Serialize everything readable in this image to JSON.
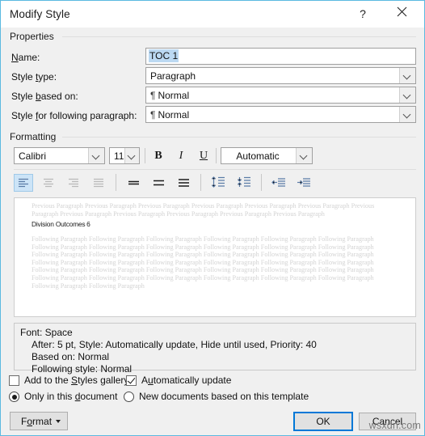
{
  "window": {
    "title": "Modify Style",
    "help_label": "?",
    "close_label": "✕"
  },
  "properties": {
    "group_label": "Properties",
    "name_label": "Name:",
    "name_value": "TOC 1",
    "style_type_label": "Style type:",
    "style_type_value": "Paragraph",
    "style_based_on_label": "Style based on:",
    "style_based_on_value": "Normal",
    "style_following_label": "Style for following paragraph:",
    "style_following_value": "Normal",
    "pilcrow": "¶"
  },
  "formatting": {
    "group_label": "Formatting",
    "font_family": "Calibri",
    "font_size": "11",
    "bold_label": "B",
    "italic_label": "I",
    "underline_label": "U",
    "font_color": "Automatic",
    "icons": {
      "align_left": "align-left-icon",
      "align_center": "align-center-icon",
      "align_right": "align-right-icon",
      "align_justify": "align-justify-icon",
      "line_spacing_1": "line-spacing-single-icon",
      "line_spacing_15": "line-spacing-1-5-icon",
      "line_spacing_2": "line-spacing-double-icon",
      "space_before": "increase-paragraph-spacing-icon",
      "space_after": "decrease-paragraph-spacing-icon",
      "decrease_indent": "decrease-indent-icon",
      "increase_indent": "increase-indent-icon"
    }
  },
  "preview": {
    "previous_paragraph": "Previous Paragraph Previous Paragraph Previous Paragraph Previous Paragraph Previous Paragraph Previous Paragraph Previous Paragraph Previous Paragraph Previous Paragraph Previous Paragraph Previous Paragraph Previous Paragraph",
    "sample_text": "Division Outcomes\t6",
    "following_paragraph": "Following Paragraph Following Paragraph Following Paragraph Following Paragraph Following Paragraph Following Paragraph Following Paragraph Following Paragraph Following Paragraph Following Paragraph Following Paragraph Following Paragraph Following Paragraph Following Paragraph Following Paragraph Following Paragraph Following Paragraph Following Paragraph Following Paragraph Following Paragraph Following Paragraph Following Paragraph Following Paragraph Following Paragraph Following Paragraph Following Paragraph Following Paragraph Following Paragraph Following Paragraph Following Paragraph Following Paragraph Following Paragraph Following Paragraph Following Paragraph Following Paragraph Following Paragraph Following Paragraph Following Paragraph"
  },
  "description": {
    "line1": "Font: Space",
    "line2": "After:  5 pt, Style: Automatically update, Hide until used, Priority: 40",
    "line3": "Based on: Normal",
    "line4": "Following style: Normal"
  },
  "options": {
    "add_to_gallery_label": "Add to the Styles gallery",
    "add_to_gallery_checked": false,
    "auto_update_label": "Automatically update",
    "auto_update_checked": true,
    "only_this_document_label": "Only in this document",
    "new_documents_label": "New documents based on this template",
    "scope_selected": "only_this_document"
  },
  "buttons": {
    "format_label": "Format",
    "ok_label": "OK",
    "cancel_label": "Cancel"
  },
  "watermark": "wsxdn.com",
  "colors": {
    "dialog_border": "#5bb9e0",
    "accent": "#0078d7",
    "selection": "#bcd9f2",
    "toolbar_icon": "#4a6fa5"
  }
}
